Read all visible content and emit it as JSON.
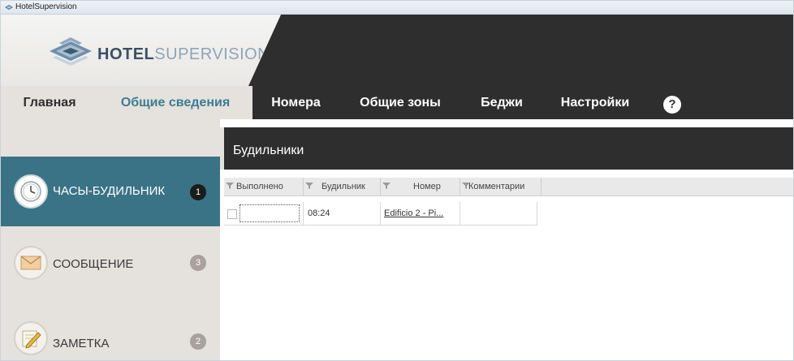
{
  "window": {
    "title": "HotelSupervision"
  },
  "logo": {
    "bold": "HOTEL",
    "light": "SUPERVISION"
  },
  "nav": {
    "items": [
      "Главная",
      "Общие сведения",
      "Номера",
      "Общие зоны",
      "Беджи",
      "Настройки"
    ],
    "active": "Общие сведения",
    "help": "?"
  },
  "sidebar": {
    "items": [
      {
        "label": "ЧАСЫ-БУДИЛЬНИК",
        "badge": "1",
        "icon": "alarm-clock-icon",
        "active": true
      },
      {
        "label": "СООБЩЕНИЕ",
        "badge": "3",
        "icon": "envelope-icon",
        "active": false
      },
      {
        "label": "ЗАМЕТКА",
        "badge": "2",
        "icon": "note-pencil-icon",
        "active": false
      }
    ]
  },
  "panel": {
    "title": "Будильники",
    "columns": [
      "Выполнено",
      "Будильник",
      "Номер",
      "Комментарии"
    ],
    "rows": [
      {
        "done": false,
        "alarm": "08:24",
        "room": "Edificio 2 - Pi...",
        "comment": ""
      }
    ]
  },
  "colors": {
    "dark_bar": "#2e2e2e",
    "accent_teal": "#3b7386",
    "active_tab_text": "#3c7d91",
    "sidebar_bg": "#e5e1dd"
  }
}
